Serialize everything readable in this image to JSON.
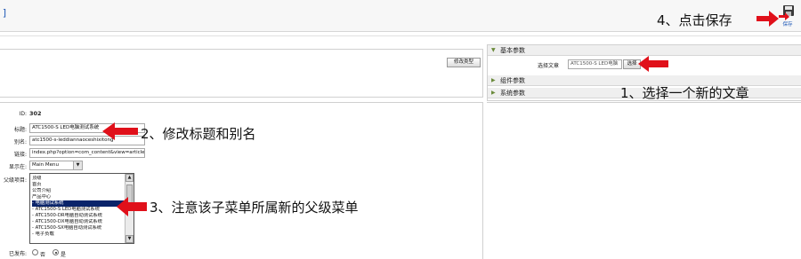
{
  "topbar": {
    "left_glyph": "]",
    "save_label": "保存"
  },
  "params": {
    "basic": "基本参数",
    "component": "组件参数",
    "system": "系统参数",
    "select_article_label": "选择文章",
    "select_article_value": "ATC1500-S LED电脑",
    "select_button": "选择"
  },
  "left_top": {
    "modify_type_button": "修改类型"
  },
  "form": {
    "id_label": "ID:",
    "id_value": "302",
    "title_label": "标题:",
    "title_value": "ATC1500-S LED电脑测试系统",
    "alias_label": "别名:",
    "alias_value": "atc1500-s-leddiannaoceshixitong",
    "link_label": "链接:",
    "link_value": "index.php?option=com_content&view=article&",
    "display_label": "显示在:",
    "display_value": "Main Menu",
    "parent_label": "父级项目:",
    "parent_items": [
      "顶级",
      " 首页",
      " 公司介绍",
      " 产品中心",
      " - 电脑测试系统",
      " - ATC1500-S LED电脑测试系统",
      " - ATC1500-DR电脑自动测试系统",
      " - ATC1500-DX电脑自动测试系统",
      " - ATC1500-SX电脑自动测试系统",
      " - 电子负载"
    ],
    "selected_index": 4,
    "published_label": "已发布:",
    "published_no": "否",
    "published_yes": "是"
  },
  "annotations": {
    "step1": "1、选择一个新的文章",
    "step2": "2、修改标题和别名",
    "step3": "3、注意该子菜单所属新的父级菜单",
    "step4": "4、点击保存"
  },
  "colors": {
    "arrow": "#e0101a",
    "selection": "#0a246a",
    "link_blue": "#1a55b5"
  },
  "icons": {
    "save": "floppy-disk-icon",
    "collapse": "triangle-down-icon",
    "expand": "triangle-right-icon"
  }
}
